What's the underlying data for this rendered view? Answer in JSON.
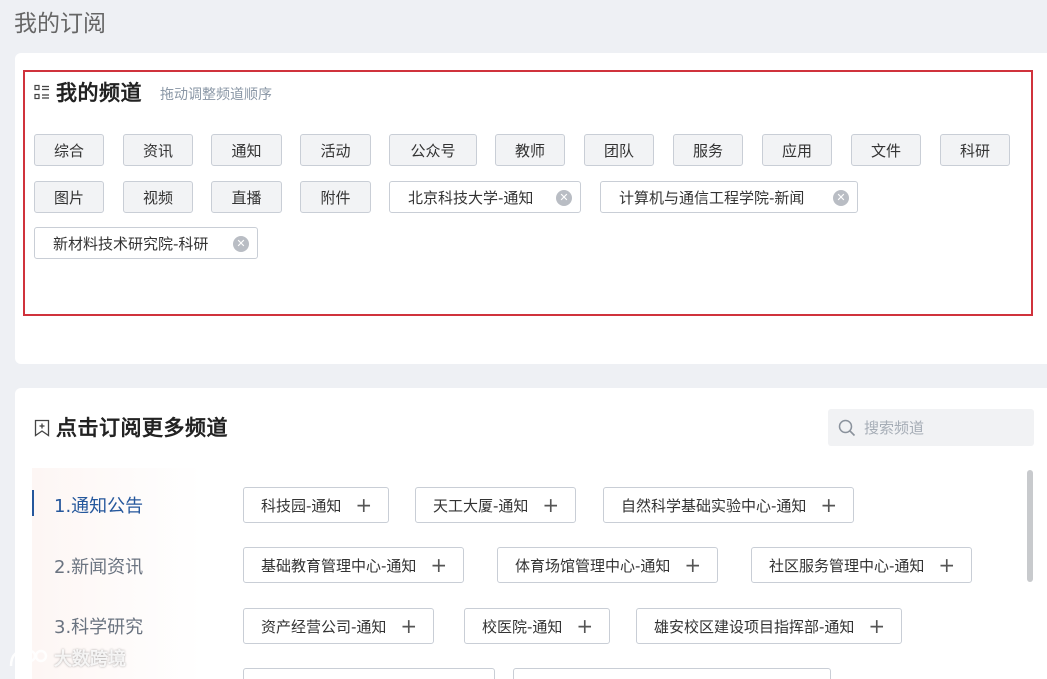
{
  "page": {
    "title": "我的订阅"
  },
  "my_channels": {
    "title": "我的频道",
    "hint": "拖动调整频道顺序",
    "chips": [
      {
        "label": "综合"
      },
      {
        "label": "资讯"
      },
      {
        "label": "通知"
      },
      {
        "label": "活动"
      },
      {
        "label": "公众号"
      },
      {
        "label": "教师"
      },
      {
        "label": "团队"
      },
      {
        "label": "服务"
      },
      {
        "label": "应用"
      },
      {
        "label": "文件"
      },
      {
        "label": "科研"
      },
      {
        "label": "图片"
      },
      {
        "label": "视频"
      },
      {
        "label": "直播"
      },
      {
        "label": "附件"
      },
      {
        "label": "北京科技大学-通知",
        "removable": true
      },
      {
        "label": "计算机与通信工程学院-新闻",
        "removable": true
      },
      {
        "label": "新材料技术研究院-科研",
        "removable": true
      }
    ]
  },
  "more_channels": {
    "title": "点击订阅更多频道",
    "search_placeholder": "搜索频道",
    "categories": [
      {
        "label": "1.通知公告",
        "active": true
      },
      {
        "label": "2.新闻资讯"
      },
      {
        "label": "3.科学研究"
      }
    ],
    "items": [
      {
        "label": "科技园-通知"
      },
      {
        "label": "天工大厦-通知"
      },
      {
        "label": "自然科学基础实验中心-通知"
      },
      {
        "label": "基础教育管理中心-通知"
      },
      {
        "label": "体育场馆管理中心-通知"
      },
      {
        "label": "社区服务管理中心-通知"
      },
      {
        "label": "资产经营公司-通知"
      },
      {
        "label": "校医院-通知"
      },
      {
        "label": "雄安校区建设项目指挥部-通知"
      }
    ]
  },
  "watermark": {
    "text": "大数跨境"
  },
  "colors": {
    "accent": "#25579c",
    "highlight_border": "#d0323c"
  }
}
